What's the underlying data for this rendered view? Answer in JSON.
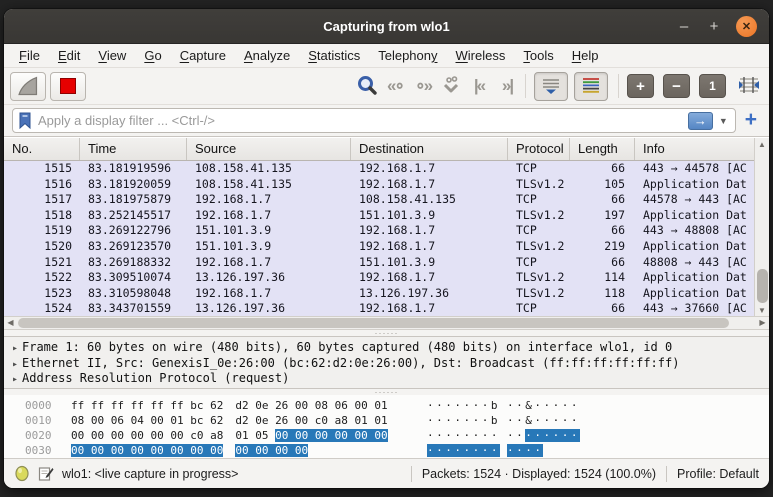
{
  "window": {
    "title": "Capturing from wlo1",
    "minimize": "–",
    "maximize": "+",
    "close": "✕"
  },
  "menu": {
    "items": [
      {
        "pre": "",
        "key": "F",
        "post": "ile"
      },
      {
        "pre": "",
        "key": "E",
        "post": "dit"
      },
      {
        "pre": "",
        "key": "V",
        "post": "iew"
      },
      {
        "pre": "",
        "key": "G",
        "post": "o"
      },
      {
        "pre": "",
        "key": "C",
        "post": "apture"
      },
      {
        "pre": "",
        "key": "A",
        "post": "nalyze"
      },
      {
        "pre": "",
        "key": "S",
        "post": "tatistics"
      },
      {
        "pre": "Telephon",
        "key": "y",
        "post": ""
      },
      {
        "pre": "",
        "key": "W",
        "post": "ireless"
      },
      {
        "pre": "",
        "key": "T",
        "post": "ools"
      },
      {
        "pre": "",
        "key": "H",
        "post": "elp"
      }
    ]
  },
  "toolbar": {
    "zoom_in": "+",
    "zoom_out": "−",
    "zoom_one": "1"
  },
  "filter": {
    "placeholder": "Apply a display filter ... <Ctrl-/>"
  },
  "packet_list": {
    "columns": [
      "No.",
      "Time",
      "Source",
      "Destination",
      "Protocol",
      "Length",
      "Info"
    ],
    "rows": [
      {
        "no": "1515",
        "time": "83.181919596",
        "source": "108.158.41.135",
        "destination": "192.168.1.7",
        "protocol": "TCP",
        "length": "66",
        "info": "443 → 44578 [AC"
      },
      {
        "no": "1516",
        "time": "83.181920059",
        "source": "108.158.41.135",
        "destination": "192.168.1.7",
        "protocol": "TLSv1.2",
        "length": "105",
        "info": "Application Dat"
      },
      {
        "no": "1517",
        "time": "83.181975879",
        "source": "192.168.1.7",
        "destination": "108.158.41.135",
        "protocol": "TCP",
        "length": "66",
        "info": "44578 → 443 [AC"
      },
      {
        "no": "1518",
        "time": "83.252145517",
        "source": "192.168.1.7",
        "destination": "151.101.3.9",
        "protocol": "TLSv1.2",
        "length": "197",
        "info": "Application Dat"
      },
      {
        "no": "1519",
        "time": "83.269122796",
        "source": "151.101.3.9",
        "destination": "192.168.1.7",
        "protocol": "TCP",
        "length": "66",
        "info": "443 → 48808 [AC"
      },
      {
        "no": "1520",
        "time": "83.269123570",
        "source": "151.101.3.9",
        "destination": "192.168.1.7",
        "protocol": "TLSv1.2",
        "length": "219",
        "info": "Application Dat"
      },
      {
        "no": "1521",
        "time": "83.269188332",
        "source": "192.168.1.7",
        "destination": "151.101.3.9",
        "protocol": "TCP",
        "length": "66",
        "info": "48808 → 443 [AC"
      },
      {
        "no": "1522",
        "time": "83.309510074",
        "source": "13.126.197.36",
        "destination": "192.168.1.7",
        "protocol": "TLSv1.2",
        "length": "114",
        "info": "Application Dat"
      },
      {
        "no": "1523",
        "time": "83.310598048",
        "source": "192.168.1.7",
        "destination": "13.126.197.36",
        "protocol": "TLSv1.2",
        "length": "118",
        "info": "Application Dat"
      },
      {
        "no": "1524",
        "time": "83.343701559",
        "source": "13.126.197.36",
        "destination": "192.168.1.7",
        "protocol": "TCP",
        "length": "66",
        "info": "443 → 37660 [AC"
      }
    ]
  },
  "details": {
    "lines": [
      "Frame 1: 60 bytes on wire (480 bits), 60 bytes captured (480 bits) on interface wlo1, id 0",
      "Ethernet II, Src: GenexisI_0e:26:00 (bc:62:d2:0e:26:00), Dst: Broadcast (ff:ff:ff:ff:ff:ff)",
      "Address Resolution Protocol (request)"
    ]
  },
  "hex": {
    "rows": [
      {
        "offset": "0000",
        "hex": [
          {
            "t": "ff ff ff ff ff ff bc 62",
            "hl": false,
            "gap": false
          },
          {
            "t": "d2 0e 26 00 08 06 00 01",
            "hl": false,
            "gap": true
          }
        ],
        "ascii": [
          {
            "t": "·······b",
            "hl": false,
            "gap": false
          },
          {
            "t": "··&·····",
            "hl": false,
            "gap": true
          }
        ]
      },
      {
        "offset": "0010",
        "hex": [
          {
            "t": "08 00 06 04 00 01 bc 62",
            "hl": false,
            "gap": false
          },
          {
            "t": "d2 0e 26 00 c0 a8 01 01",
            "hl": false,
            "gap": true
          }
        ],
        "ascii": [
          {
            "t": "·······b",
            "hl": false,
            "gap": false
          },
          {
            "t": "··&·····",
            "hl": false,
            "gap": true
          }
        ]
      },
      {
        "offset": "0020",
        "hex": [
          {
            "t": "00 00 00 00 00 00 c0 a8",
            "hl": false,
            "gap": false
          },
          {
            "t": "01 05 ",
            "hl": false,
            "gap": true
          },
          {
            "t": "00 00 00 00 00 00",
            "hl": true,
            "gap": false
          }
        ],
        "ascii": [
          {
            "t": "········",
            "hl": false,
            "gap": false
          },
          {
            "t": "··",
            "hl": false,
            "gap": true
          },
          {
            "t": "······",
            "hl": true,
            "gap": false
          }
        ]
      },
      {
        "offset": "0030",
        "hex": [
          {
            "t": "00 00 00 00 00 00 00 00",
            "hl": true,
            "gap": false
          },
          {
            "t": "00 00 00 00",
            "hl": true,
            "gap": true
          }
        ],
        "ascii": [
          {
            "t": "········",
            "hl": true,
            "gap": false
          },
          {
            "t": "····",
            "hl": true,
            "gap": true
          }
        ]
      }
    ]
  },
  "status": {
    "capture": "wlo1: <live capture in progress>",
    "packets": "Packets: 1524 · Displayed: 1524 (100.0%)",
    "profile": "Profile: Default"
  },
  "colors": {
    "accent_blue": "#3d6fc4",
    "selection_blue": "#2878b8",
    "row_bg": "#e3e2f5",
    "stop_red": "#e60000",
    "arrow_red": "#e96a5c",
    "close_orange": "#ec7424",
    "titlebar": "#3b3935"
  }
}
